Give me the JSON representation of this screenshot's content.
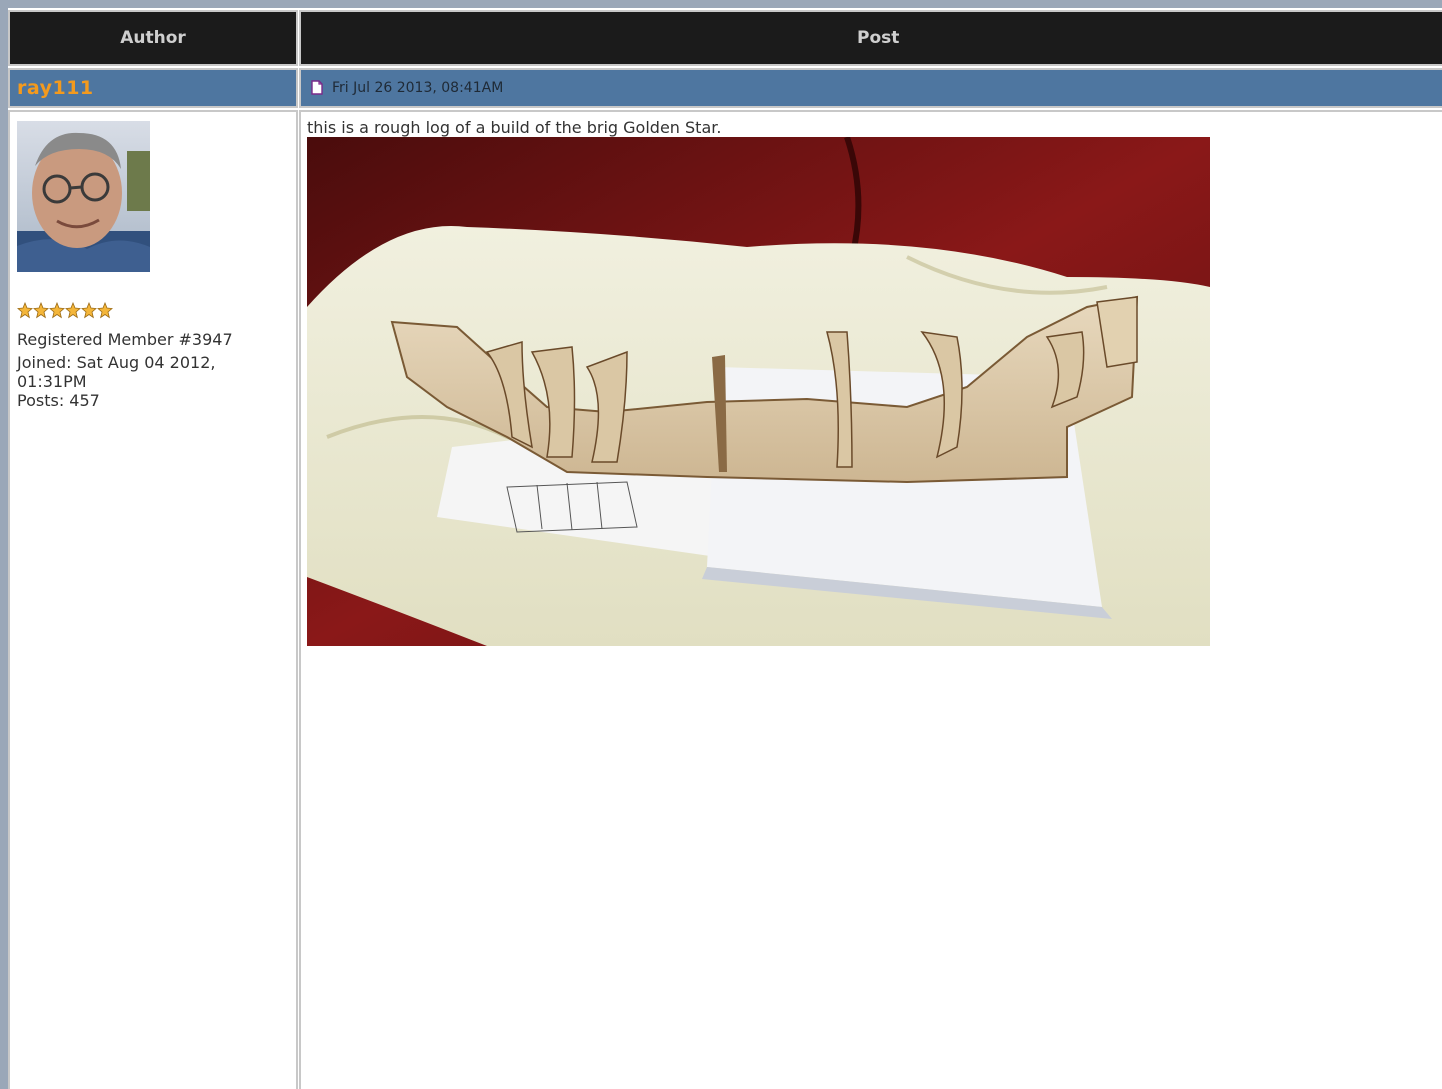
{
  "table": {
    "header_author": "Author",
    "header_post": "Post"
  },
  "post": {
    "username": "ray111",
    "icon": "post-document-icon",
    "date": "Fri Jul 26 2013, 08:41AM",
    "text": "this is a rough log of a build of the brig Golden Star.",
    "photo_icon": "ship-hull-photo"
  },
  "member": {
    "avatar_icon": "user-avatar-photo",
    "rank_stars": 6,
    "registered": "Registered Member #3947",
    "joined": "Joined: Sat Aug 04 2012, 01:31PM",
    "posts": "Posts: 457"
  },
  "colors": {
    "header_bg": "#1b1b1b",
    "meta_bg": "#4e76a0",
    "username": "#f39a1e",
    "border": "#c8c8c8"
  }
}
